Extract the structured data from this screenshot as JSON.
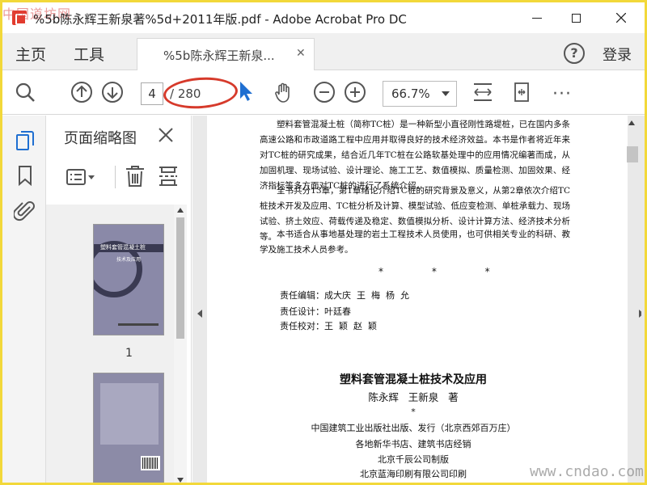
{
  "window": {
    "title": "%5b陈永辉王新泉著%5d+2011年版.pdf - Adobe Acrobat Pro DC",
    "watermark_top": "中国道坊网",
    "watermark_bottom": "www.cndao.com"
  },
  "tabs": {
    "home": "主页",
    "tools": "工具",
    "document": "%5b陈永辉王新泉...",
    "help": "?",
    "login": "登录"
  },
  "toolbar": {
    "current_page": "4",
    "total_pages": "/ 280",
    "zoom": "66.7%",
    "more": "···"
  },
  "thumbnail_panel": {
    "title": "页面缩略图",
    "page1_label": "1",
    "cover_title": "塑料套管混凝土桩",
    "cover_subtitle": "技术及应用"
  },
  "document": {
    "para1": "塑料套管混凝土桩（简称TC桩）是一种新型小直径刚性路堤桩，已在国内多条高速公路和市政道路工程中应用并取得良好的技术经济效益。本书是作者将近年来对TC桩的研究成果，结合近几年TC桩在公路软基处理中的应用情况编著而成，从加固机理、现场试验、设计理论、施工工艺、数值模拟、质量检测、加固效果、经济指标等多方面对TC桩的进行了系统介绍。",
    "para2": "全书共分13章，第1章绪论介绍TC桩的研究背景及意义，从第2章依次介绍TC桩技术开发及应用、TC桩分析及计算、模型试验、低应变检测、单桩承载力、现场试验、挤土效应、荷载传递及稳定、数值模拟分析、设计计算方法、经济技术分析等。",
    "para3": "本书适合从事地基处理的岩土工程技术人员使用，也可供相关专业的科研、教学及施工技术人员参考。",
    "stars": "* * *",
    "credit_editor": "责任编辑：成大庆  王  梅  杨  允",
    "credit_design": "责任设计：叶廷春",
    "credit_proof": "责任校对：王  颖  赵  颖",
    "book_title": "塑料套管混凝土桩技术及应用",
    "book_authors": "陈永辉   王新泉   著",
    "book_star": "*",
    "pub1": "中国建筑工业出版社出版、发行（北京西郊百万庄）",
    "pub2": "各地新华书店、建筑书店经销",
    "pub3": "北京千辰公司制版",
    "pub4": "北京蓝海印刷有限公司印刷"
  },
  "colors": {
    "annotation": "#d63a2b",
    "cursor": "#1f6fd1",
    "active_icon": "#1f6fd1"
  }
}
